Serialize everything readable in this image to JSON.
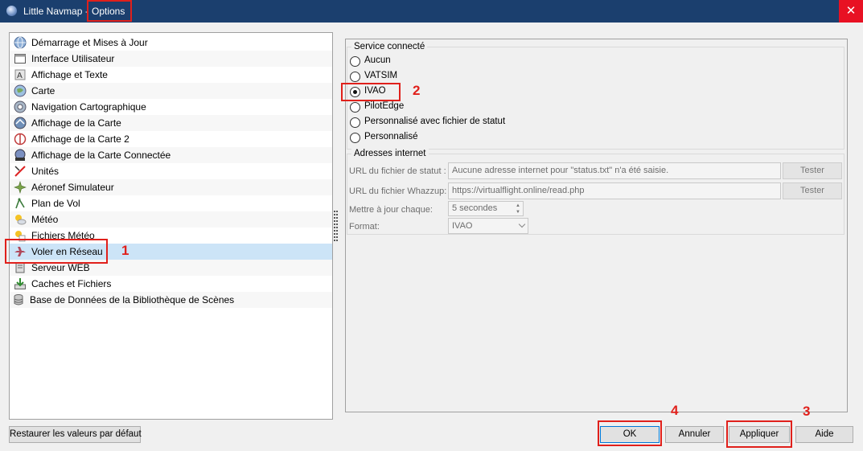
{
  "window": {
    "app_name": "Little Navmap",
    "separator": "-",
    "page": "Options",
    "close_glyph": "✕"
  },
  "nav": {
    "items": [
      {
        "label": "Démarrage et Mises à Jour",
        "icon": "globe-icon"
      },
      {
        "label": "Interface Utilisateur",
        "icon": "window-icon"
      },
      {
        "label": "Affichage et Texte",
        "icon": "font-icon"
      },
      {
        "label": "Carte",
        "icon": "map-icon"
      },
      {
        "label": "Navigation Cartographique",
        "icon": "globe-navigation-icon"
      },
      {
        "label": "Affichage de la Carte",
        "icon": "map-display-icon"
      },
      {
        "label": "Affichage de la Carte 2",
        "icon": "airport-icon"
      },
      {
        "label": "Affichage de la Carte Connectée",
        "icon": "online-map-icon"
      },
      {
        "label": "Unités",
        "icon": "units-icon"
      },
      {
        "label": "Aéronef Simulateur",
        "icon": "aircraft-icon"
      },
      {
        "label": "Plan de Vol",
        "icon": "flight-plan-icon"
      },
      {
        "label": "Météo",
        "icon": "weather-icon"
      },
      {
        "label": "Fichiers Météo",
        "icon": "weather-files-icon"
      },
      {
        "label": "Voler en Réseau",
        "icon": "plane-network-icon"
      },
      {
        "label": "Serveur WEB",
        "icon": "web-server-icon"
      },
      {
        "label": "Caches et Fichiers",
        "icon": "download-icon"
      },
      {
        "label": "Base de Données de la Bibliothèque de Scènes",
        "icon": "database-icon"
      }
    ],
    "selected_index": 13
  },
  "network": {
    "service_group_title": "Service connecté",
    "options": [
      "Aucun",
      "VATSIM",
      "IVAO",
      "PilotEdge",
      "Personnalisé avec fichier de statut",
      "Personnalisé"
    ],
    "selected": "IVAO",
    "addresses_group_title": "Adresses internet",
    "status_url_label": "URL du fichier de statut :",
    "status_url_placeholder": "Aucune adresse internet pour \"status.txt\" n'a été saisie.",
    "whazzup_url_label": "URL du fichier Whazzup:",
    "whazzup_url_value": "https://virtualflight.online/read.php",
    "test_button": "Tester",
    "update_label": "Mettre à jour chaque:",
    "update_value": "5 secondes",
    "format_label": "Format:",
    "format_value": "IVAO"
  },
  "buttons": {
    "restore": "Restaurer les valeurs par défaut",
    "ok": "OK",
    "cancel": "Annuler",
    "apply": "Appliquer",
    "help": "Aide"
  },
  "annotations": {
    "n1": "1",
    "n2": "2",
    "n3": "3",
    "n4": "4"
  },
  "colors": {
    "titlebar": "#1b3f6e",
    "annotation": "#e0201b",
    "selection": "#cce4f7",
    "close": "#e81123"
  }
}
